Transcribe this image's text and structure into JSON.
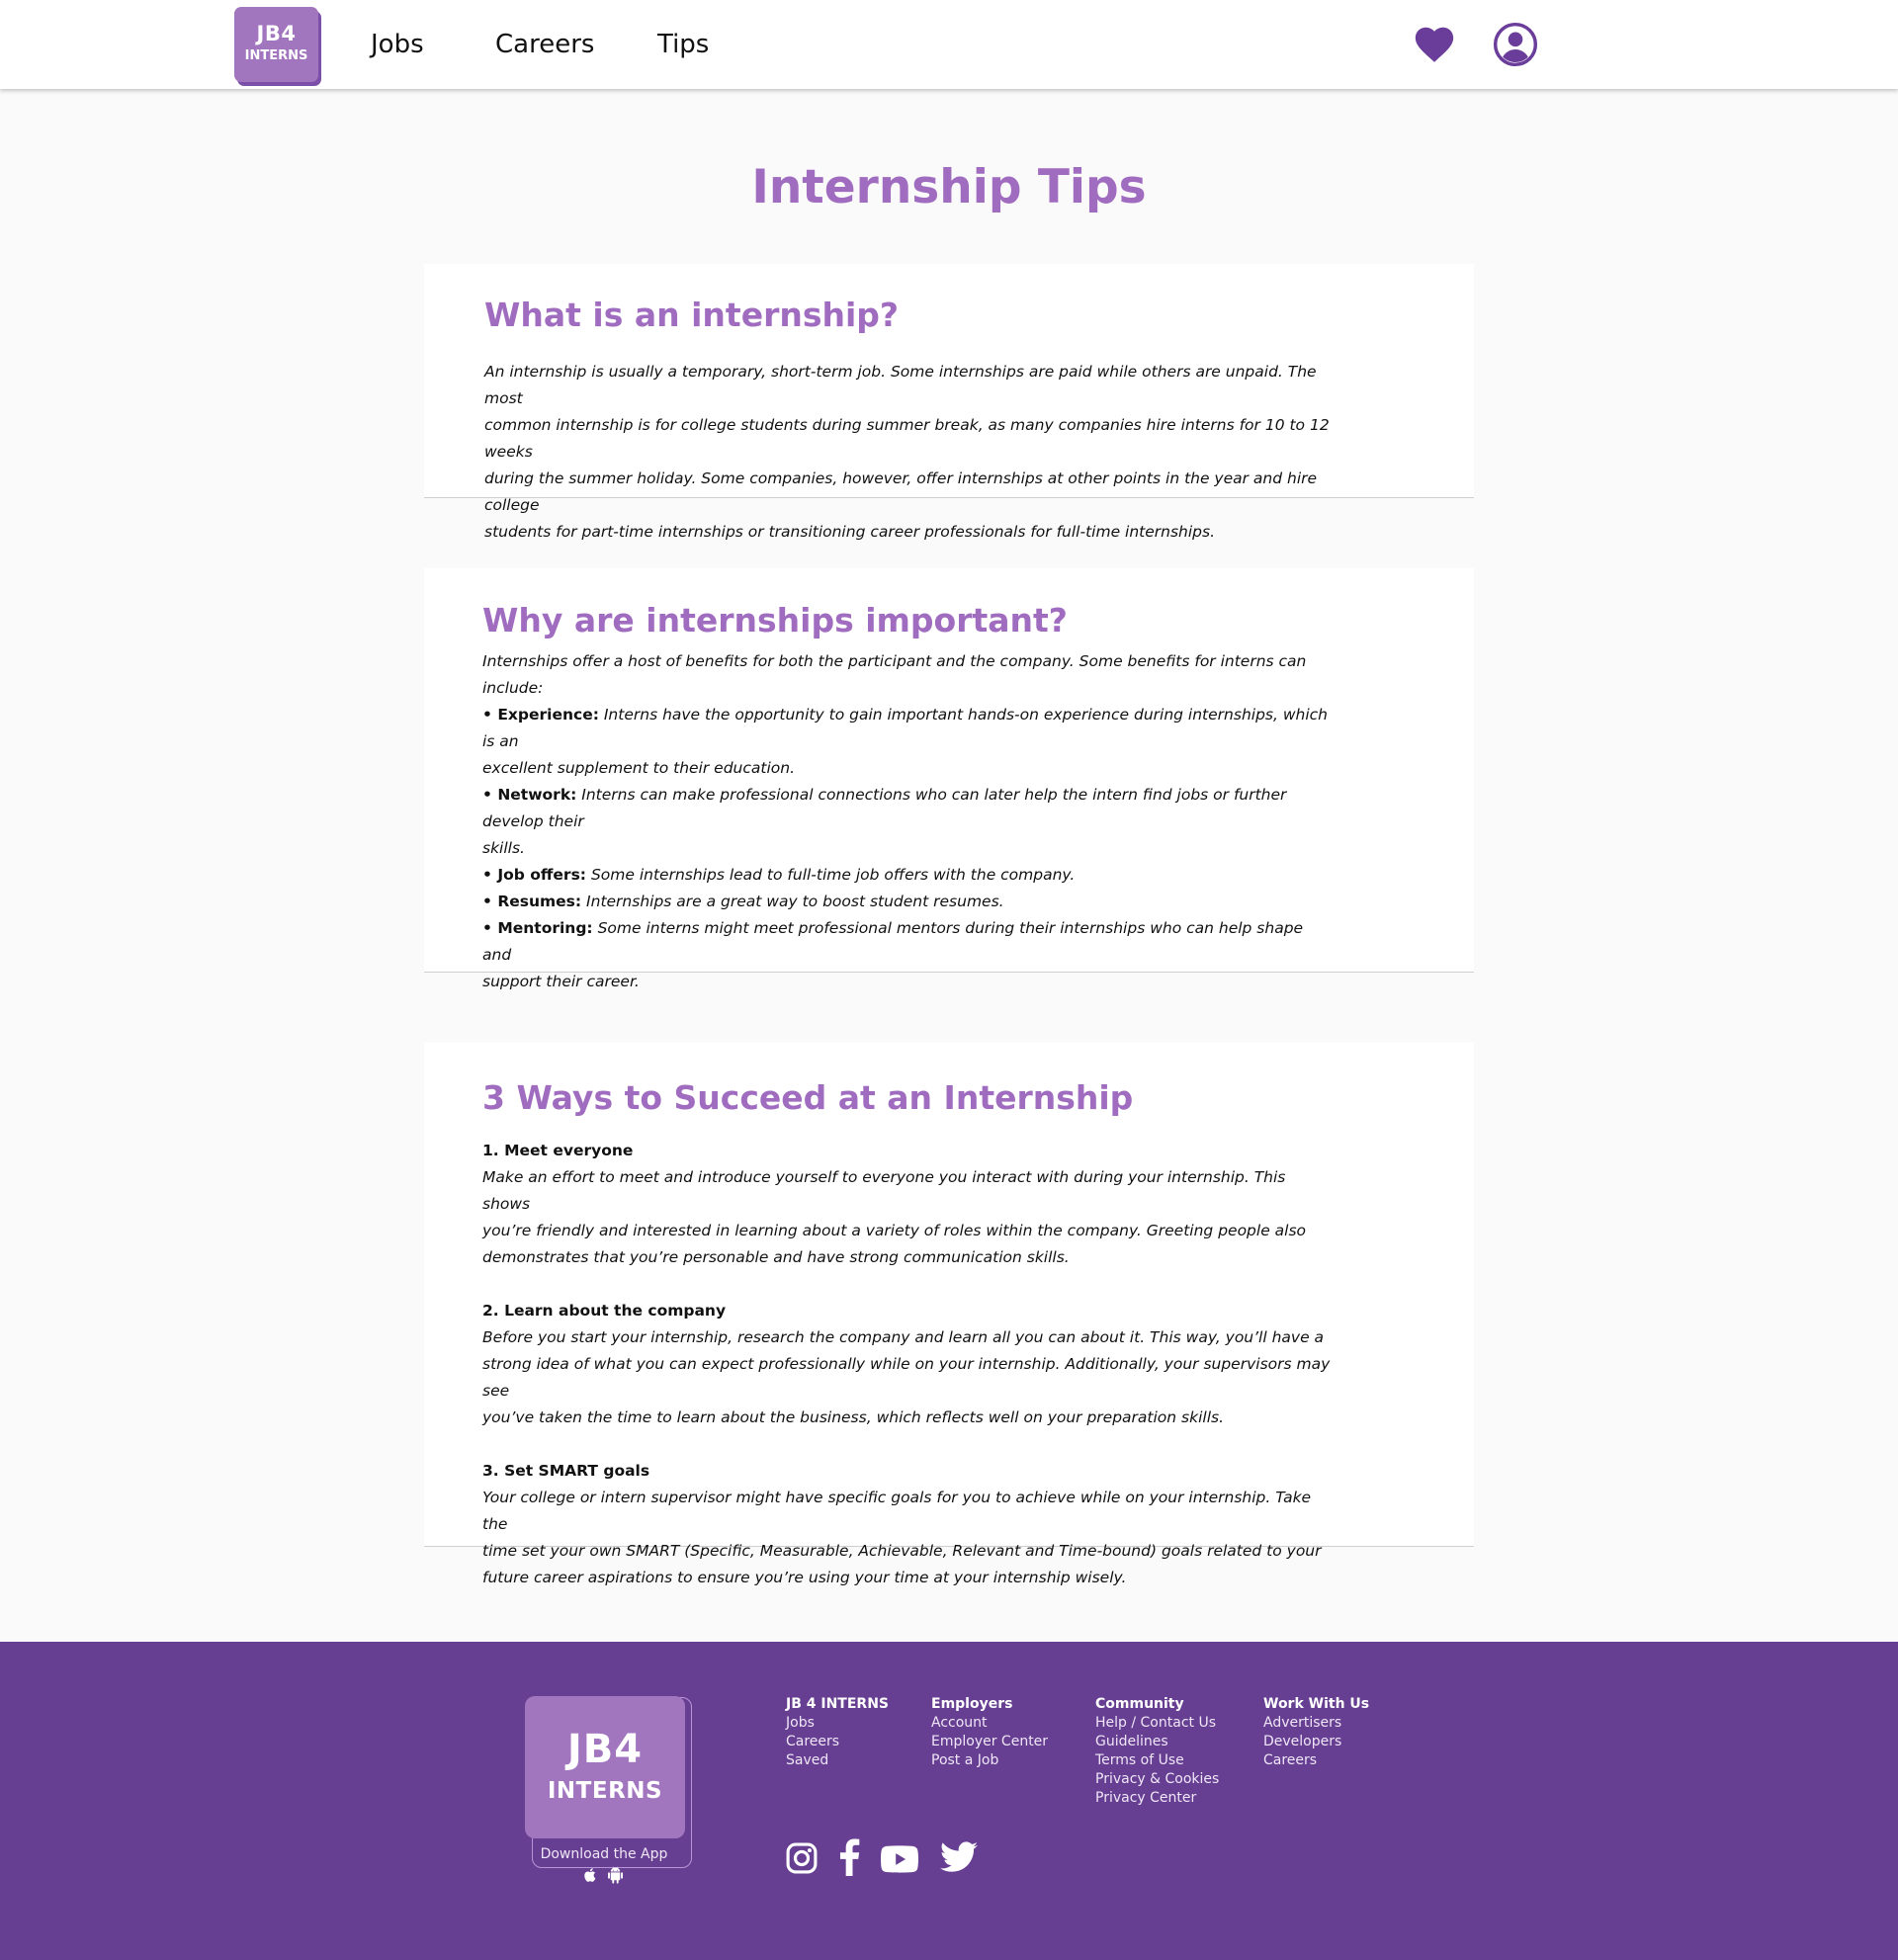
{
  "header": {
    "logo_line1": "JB4",
    "logo_line2": "INTERNS",
    "nav": {
      "jobs": "Jobs",
      "careers": "Careers",
      "tips": "Tips"
    },
    "icons": {
      "favorites": "heart-icon",
      "account": "user-circle-icon"
    },
    "accent_color": "#673f92"
  },
  "page": {
    "title": "Internship Tips",
    "title_color": "#a06cc0"
  },
  "sections": {
    "what": {
      "heading": "What is an internship?",
      "lines": [
        "An internship is usually a temporary, short-term job. Some internships are paid while others are unpaid. The most",
        "common internship is for college students during summer break, as many companies hire interns for 10 to 12 weeks",
        "during the summer holiday. Some companies, however, offer internships at other points in the year and hire college",
        "students for part-time internships or transitioning career professionals for full-time internships."
      ]
    },
    "why": {
      "heading": "Why are internships important?",
      "intro": "Internships offer a host of benefits for both the participant and the company. Some benefits for interns can include:",
      "benefits": [
        {
          "label": "Experience:",
          "line1": "Interns have the opportunity to gain important hands-on experience during internships, which is an",
          "line2": "excellent supplement to their education."
        },
        {
          "label": "Network:",
          "line1": "Interns can make professional connections who can later help the intern find jobs or further develop their",
          "line2": "skills."
        },
        {
          "label": "Job offers:",
          "line1": "Some internships lead to full-time job offers with the company.",
          "line2": ""
        },
        {
          "label": "Resumes:",
          "line1": "Internships are a great way to boost student resumes.",
          "line2": ""
        },
        {
          "label": "Mentoring:",
          "line1": "Some interns might meet professional mentors during their internships who can help shape and",
          "line2": "support their career."
        }
      ]
    },
    "ways": {
      "heading": "3 Ways to Succeed at an Internship",
      "items": [
        {
          "title": "1. Meet everyone",
          "lines": [
            "Make an effort to meet and introduce yourself to everyone you interact with during your internship. This shows",
            "you’re friendly and interested in learning about a variety of roles within the company. Greeting people also",
            "demonstrates that you’re personable and have strong communication skills."
          ]
        },
        {
          "title": "2. Learn about the company",
          "lines": [
            "Before you start your internship, research the company and learn all you can about it. This way, you’ll have a",
            "strong idea of what you can expect professionally while on your internship. Additionally, your supervisors may see",
            "you’ve taken the time to learn about the business, which reflects well on your preparation skills."
          ]
        },
        {
          "title": "3. Set SMART goals",
          "lines": [
            "Your college or intern supervisor might have specific goals for you to achieve while on your internship. Take the",
            "time set your own SMART (Specific, Measurable, Achievable, Relevant and Time-bound) goals related to your",
            "future career aspirations to ensure you’re using your time at your internship wisely."
          ]
        }
      ]
    }
  },
  "footer": {
    "logo_line1": "JB4",
    "logo_line2": "INTERNS",
    "download_label": "Download the App",
    "app_icons": [
      "apple-icon",
      "android-icon"
    ],
    "columns": [
      {
        "heading": "JB 4 INTERNS",
        "links": [
          "Jobs",
          "Careers",
          "Saved"
        ]
      },
      {
        "heading": "Employers",
        "links": [
          "Account",
          "Employer Center",
          "Post a Job"
        ]
      },
      {
        "heading": "Community",
        "links": [
          "Help / Contact Us",
          "Guidelines",
          "Terms of Use",
          "Privacy & Cookies",
          "Privacy Center"
        ]
      },
      {
        "heading": "Work With Us",
        "links": [
          "Advertisers",
          "Developers",
          "Careers"
        ]
      }
    ],
    "social": [
      "instagram-icon",
      "facebook-icon",
      "youtube-icon",
      "twitter-icon"
    ],
    "background_color": "#673f92"
  }
}
